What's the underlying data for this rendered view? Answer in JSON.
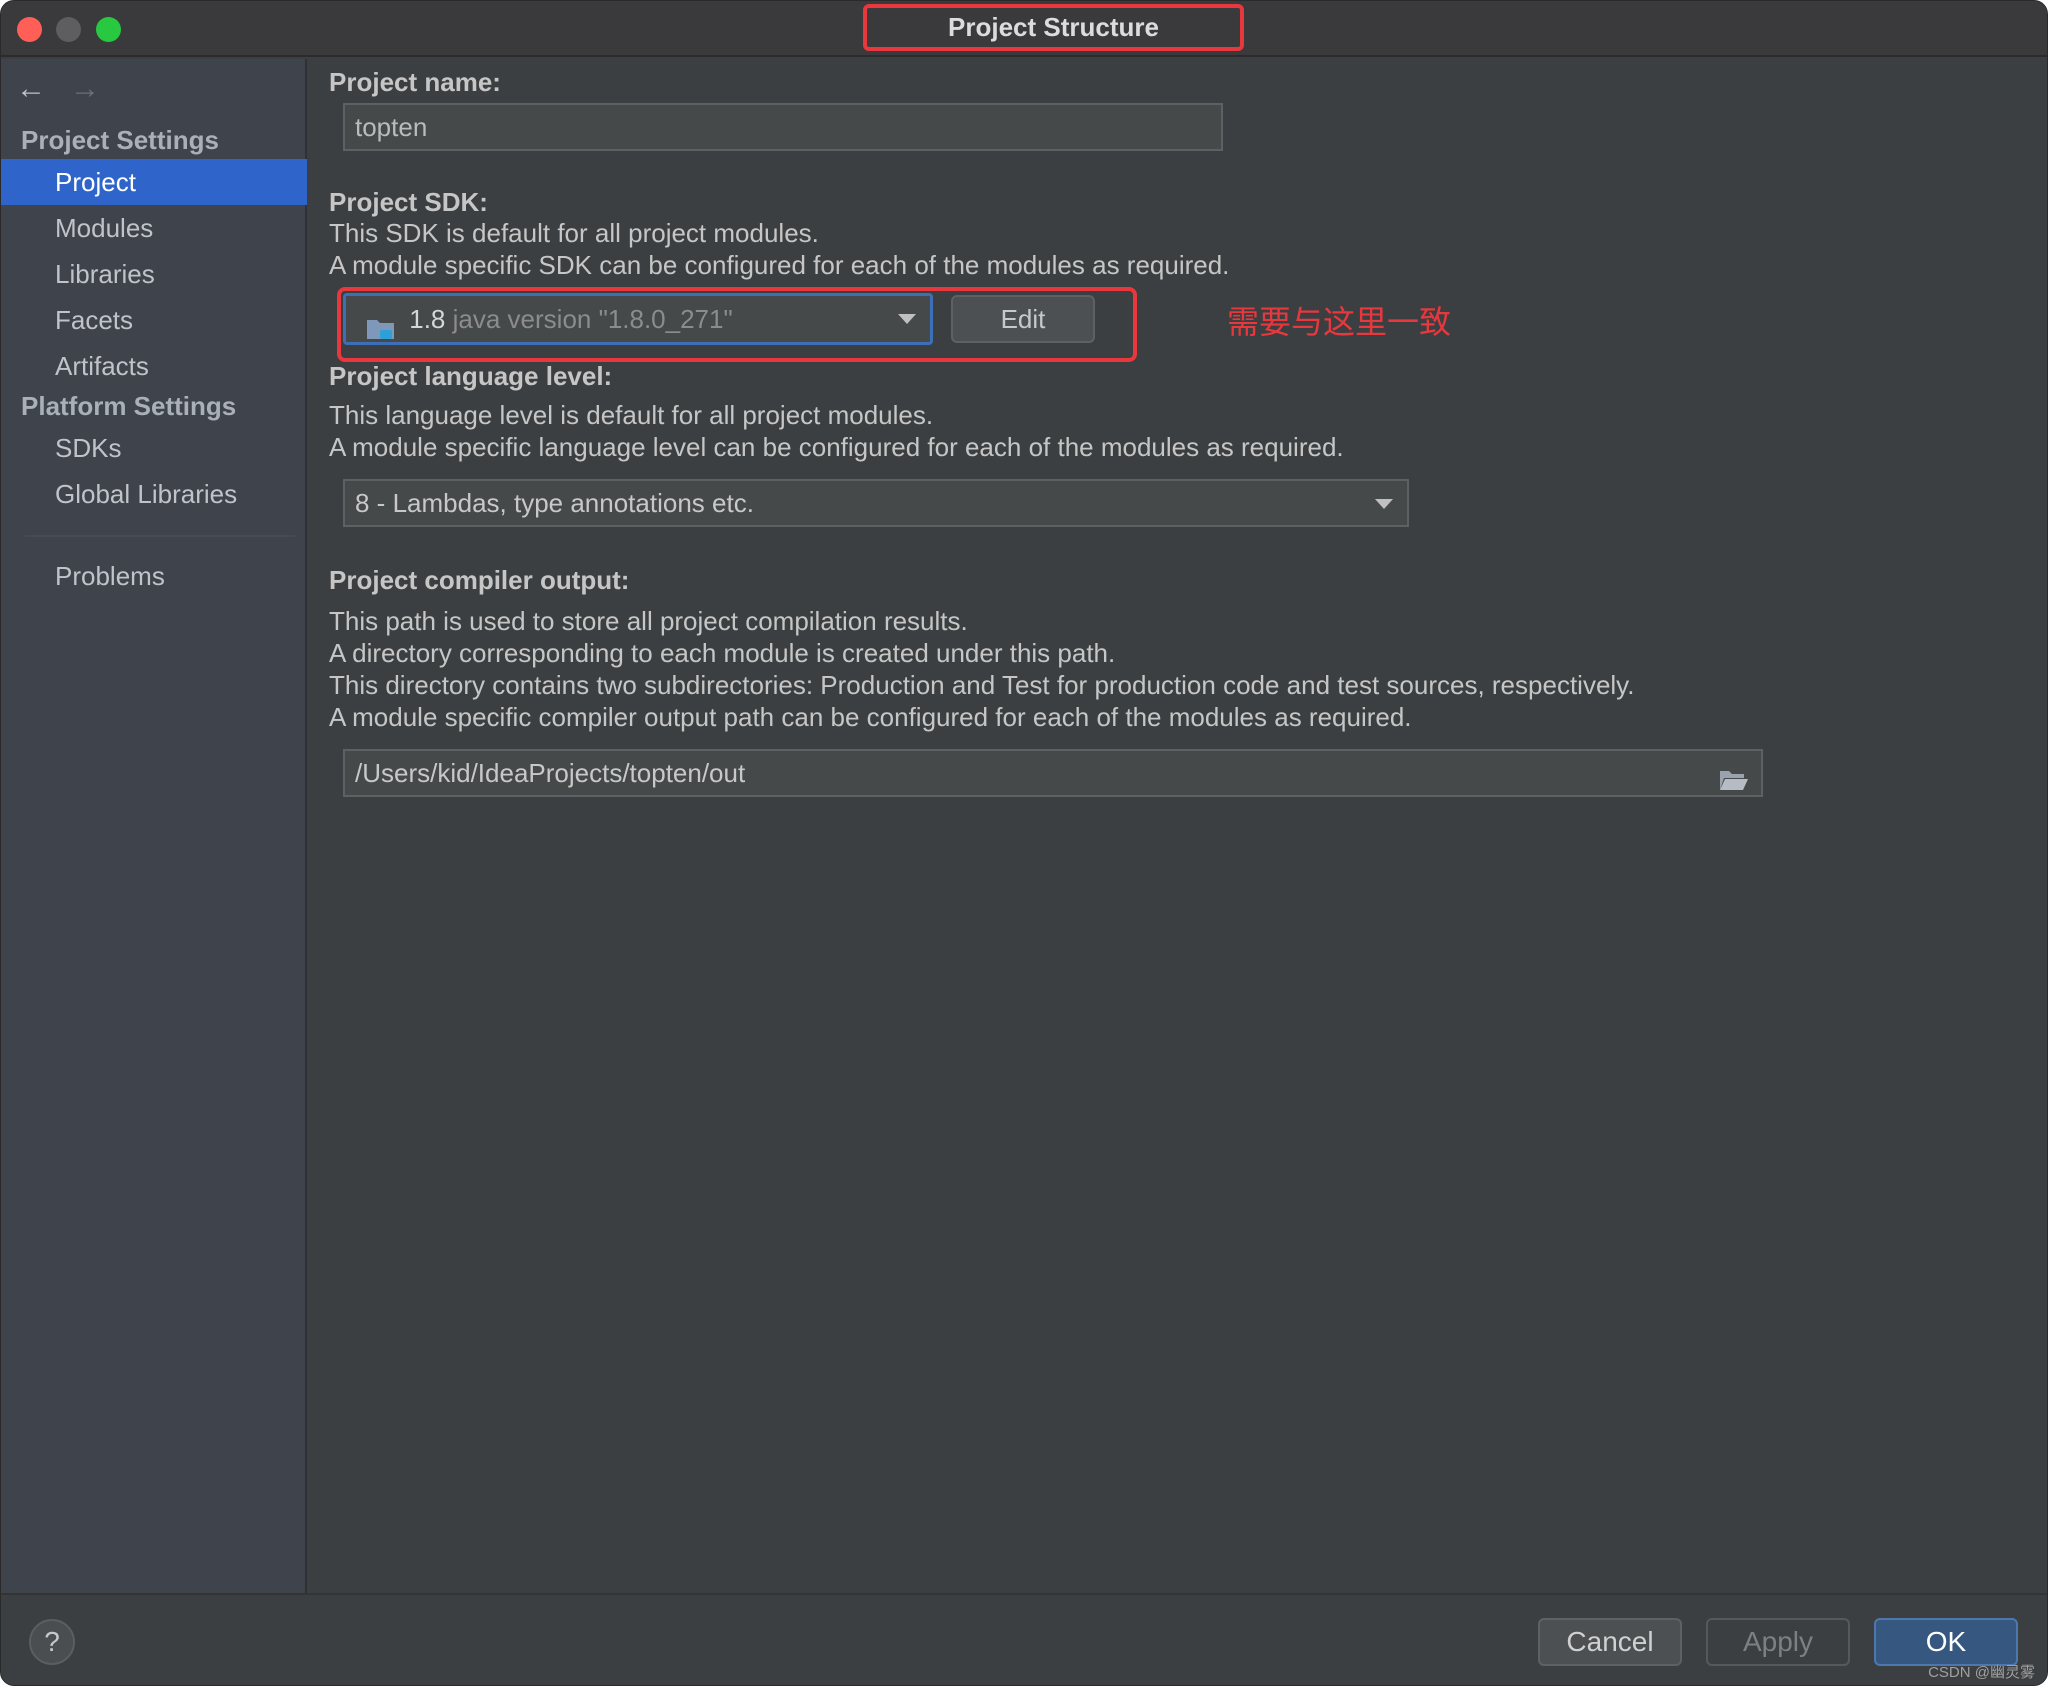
{
  "window": {
    "title": "Project Structure"
  },
  "nav": {
    "back_label": "←",
    "forward_label": "→"
  },
  "sidebar": {
    "project_settings_header": "Project Settings",
    "platform_settings_header": "Platform Settings",
    "items": [
      {
        "label": "Project",
        "selected": true
      },
      {
        "label": "Modules"
      },
      {
        "label": "Libraries"
      },
      {
        "label": "Facets"
      },
      {
        "label": "Artifacts"
      },
      {
        "label": "SDKs"
      },
      {
        "label": "Global Libraries"
      },
      {
        "label": "Problems"
      }
    ]
  },
  "main": {
    "project_name": {
      "label": "Project name:",
      "value": "topten"
    },
    "project_sdk": {
      "label": "Project SDK:",
      "desc1": "This SDK is default for all project modules.",
      "desc2": "A module specific SDK can be configured for each of the modules as required.",
      "version": "1.8",
      "version_detail": "java version \"1.8.0_271\"",
      "edit_label": "Edit",
      "annotation": "需要与这里一致"
    },
    "language_level": {
      "label": "Project language level:",
      "desc1": "This language level is default for all project modules.",
      "desc2": "A module specific language level can be configured for each of the modules as required.",
      "value": "8 - Lambdas, type annotations etc."
    },
    "compiler_output": {
      "label": "Project compiler output:",
      "desc1": "This path is used to store all project compilation results.",
      "desc2": "A directory corresponding to each module is created under this path.",
      "desc3": "This directory contains two subdirectories: Production and Test for production code and test sources, respectively.",
      "desc4": "A module specific compiler output path can be configured for each of the modules as required.",
      "path": "/Users/kid/IdeaProjects/topten/out"
    }
  },
  "footer": {
    "help_label": "?",
    "cancel_label": "Cancel",
    "apply_label": "Apply",
    "ok_label": "OK",
    "watermark": "CSDN @幽灵雾"
  },
  "colors": {
    "selection": "#2f65ca",
    "highlight_red": "#e8383d",
    "background": "#3c3f41"
  }
}
